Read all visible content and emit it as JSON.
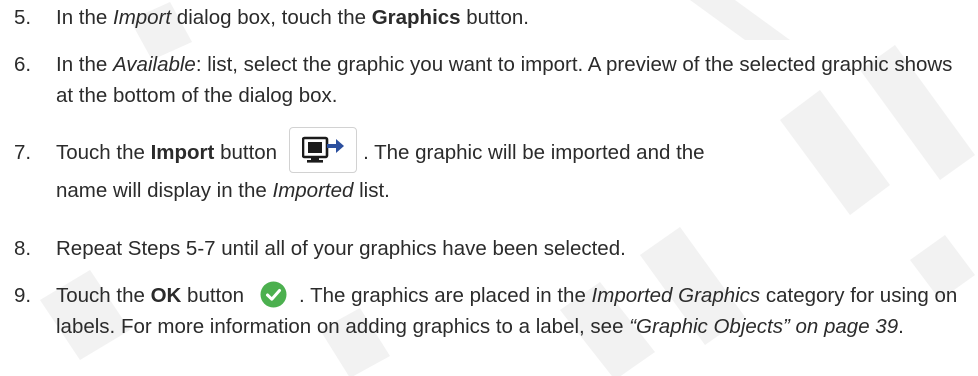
{
  "colors": {
    "watermark": "#f2f2f2",
    "ok_green": "#4cb04f",
    "import_icon_dark": "#1b1b1b",
    "import_icon_arrow": "#2b4f9e"
  },
  "steps": [
    {
      "number": "5.",
      "t1": "In the ",
      "t2": "Import",
      "t3": " dialog box, touch the ",
      "t4": "Graphics",
      "t5": " button."
    },
    {
      "number": "6.",
      "t1": "In the ",
      "t2": "Available",
      "t3": ": list, select the graphic you want to import. A preview of the selected graphic shows at the bottom of the dialog box."
    },
    {
      "number": "7.",
      "t1": "Touch the ",
      "t2": "Import",
      "t3": " button",
      "icon": "import-icon",
      "t4": ". The graphic will be imported and the",
      "t5": "name will display in the ",
      "t6": "Imported",
      "t7": " list."
    },
    {
      "number": "8.",
      "t1": "Repeat Steps 5-7 until all of your graphics have been selected."
    },
    {
      "number": "9.",
      "t1": "Touch the ",
      "t2": "OK",
      "t3": " button",
      "icon": "ok-check-icon",
      "t4": ". The graphics are placed in the ",
      "t5": "Imported Graphics",
      "t6": " category for using on labels. For more information on adding graphics to a label, see ",
      "t7": "“Graphic Objects” on page 39",
      "t8": "."
    }
  ]
}
